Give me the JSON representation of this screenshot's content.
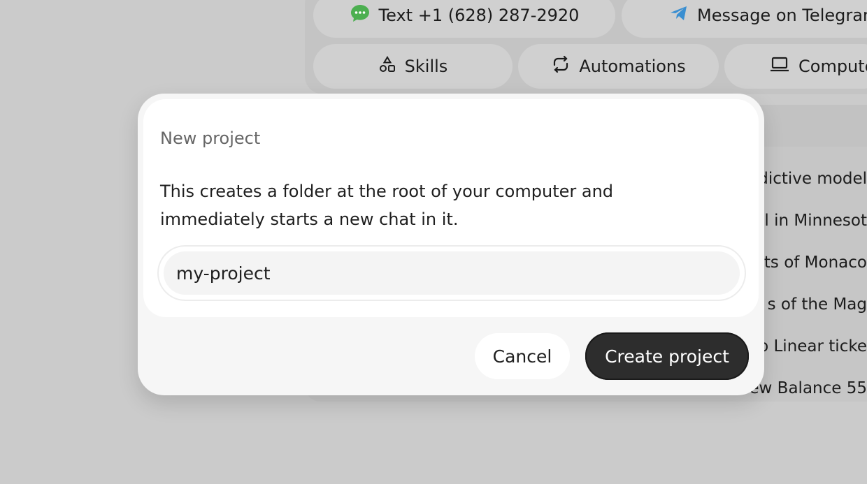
{
  "background": {
    "contact_pills": [
      {
        "label": "Text +1 (628) 287-2920",
        "icon": "chat-bubble-icon"
      },
      {
        "label": "Message on Telegram",
        "icon": "telegram-icon"
      }
    ],
    "nav_pills": [
      {
        "label": "Skills",
        "icon": "shapes-icon"
      },
      {
        "label": "Automations",
        "icon": "repeat-icon"
      },
      {
        "label": "Computer",
        "icon": "laptop-icon"
      }
    ],
    "history": [
      "dictive model",
      "l in Minnesot",
      "ts of Monaco",
      "s of the Mag",
      "o Linear ticke",
      "ew Balance 55"
    ]
  },
  "modal": {
    "title": "New project",
    "description": "This creates a folder at the root of your computer and immediately starts a new chat in it.",
    "input_value": "my-project",
    "cancel_label": "Cancel",
    "create_label": "Create project"
  },
  "colors": {
    "backdrop": "#cbcbcb",
    "primary_button": "#2d2d2d",
    "sms_icon": "#4caf50",
    "telegram_icon": "#3a8fd1"
  }
}
